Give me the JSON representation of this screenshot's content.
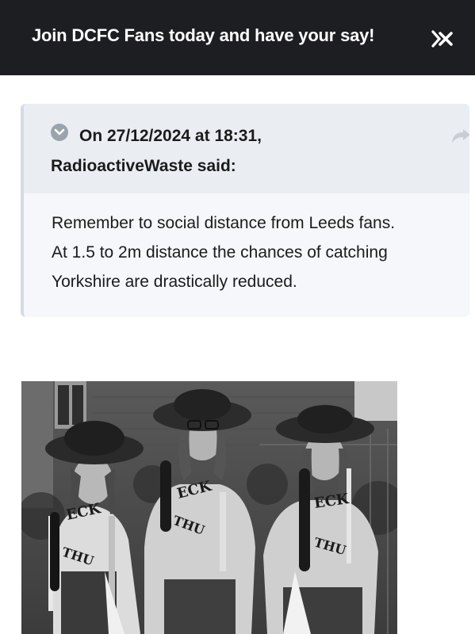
{
  "banner": {
    "text": "Join DCFC Fans today and have your say!",
    "close_icon": "close-icon"
  },
  "quote": {
    "date_line": "On 27/12/2024 at 18:31,",
    "author_line": "RadioactiveWaste said:",
    "toggle_icon": "chevron-down-icon",
    "share_icon": "share-arrow-icon",
    "body_lines": [
      "Remember to social distance from Leeds fans.",
      "At 1.5 to 2m distance the chances of catching",
      "Yorkshire are drastically reduced."
    ]
  },
  "photo": {
    "shirt_text_top": "ECK",
    "shirt_text_bottom": "THU"
  },
  "colors": {
    "banner_bg": "#1d1e22",
    "quote_bg": "#f5f7fa",
    "quote_head_bg": "#eaeef3"
  }
}
